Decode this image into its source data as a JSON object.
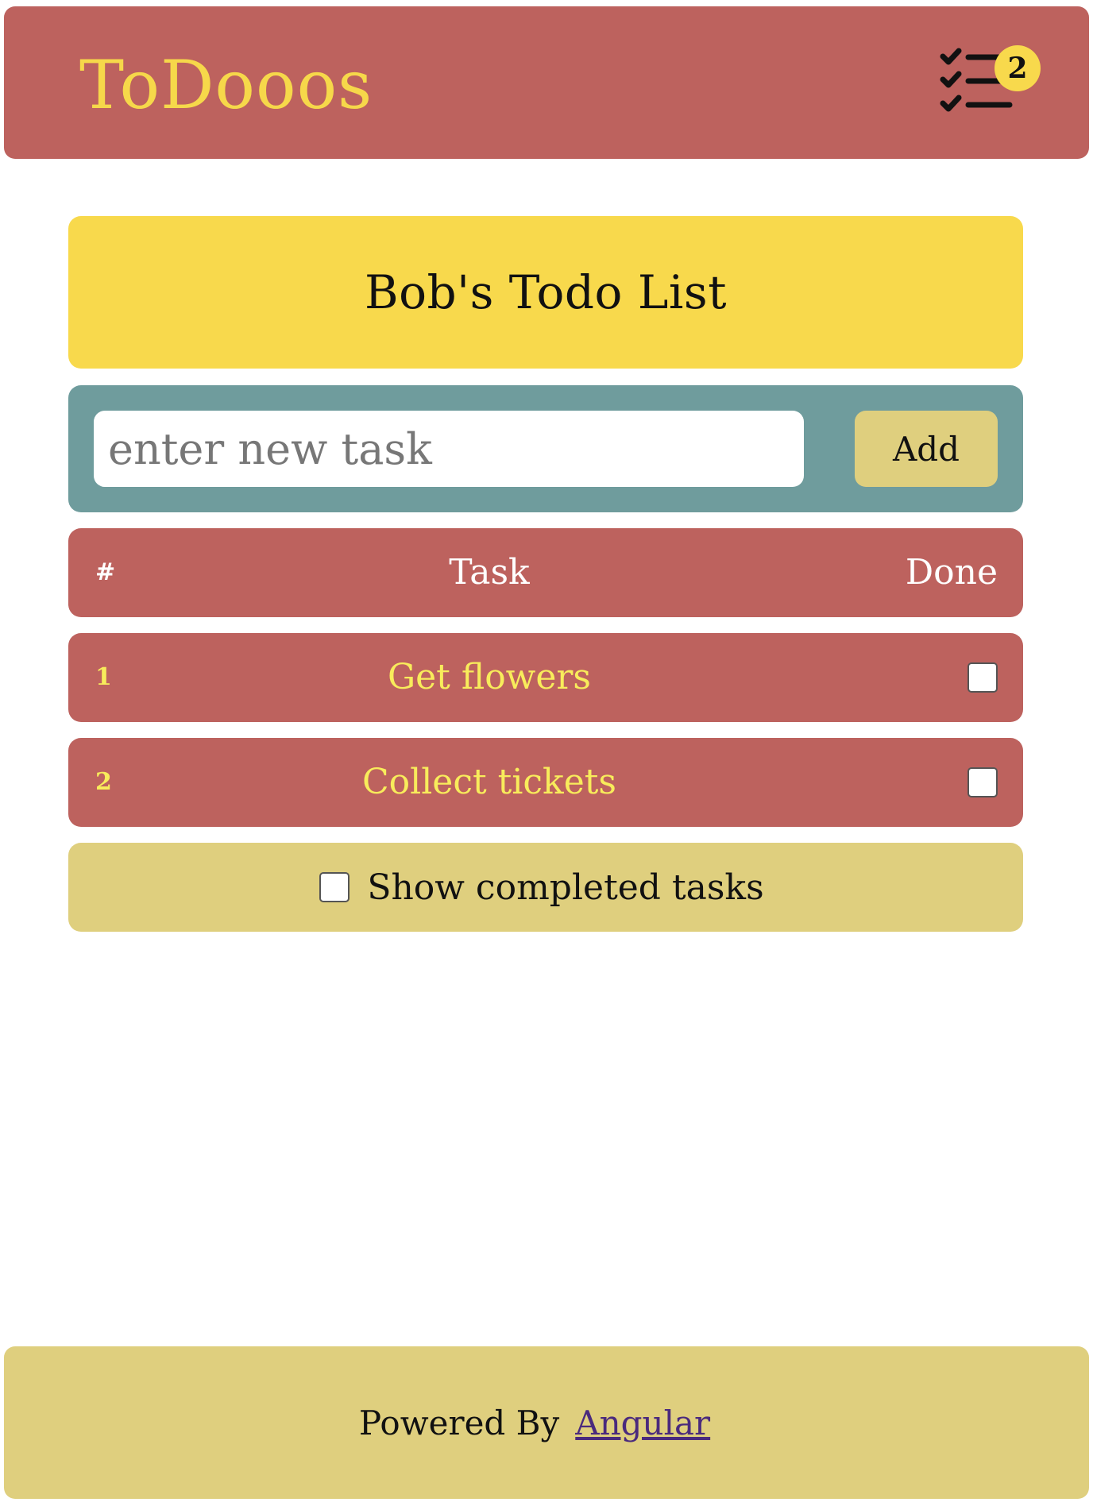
{
  "header": {
    "brand": "ToDooos",
    "tasks_icon": "checklist-icon",
    "pending_count": "2"
  },
  "title": "Bob's Todo List",
  "new_task": {
    "placeholder": "enter new task",
    "value": "",
    "add_label": "Add"
  },
  "table": {
    "headers": {
      "num": "#",
      "task": "Task",
      "done": "Done"
    },
    "rows": [
      {
        "num": "1",
        "task": "Get flowers",
        "done": false
      },
      {
        "num": "2",
        "task": "Collect tickets",
        "done": false
      }
    ]
  },
  "show_completed": {
    "label": "Show completed tasks",
    "checked": false
  },
  "footer": {
    "text": "Powered By",
    "link": "Angular"
  },
  "colors": {
    "header": "#bd625e",
    "brand_text": "#f6d84a",
    "title_card": "#f8d94c",
    "new_task_bar": "#6f9c9d",
    "button": "#dfcf7e",
    "row_text": "#f8ec5b",
    "footer": "#dfcf7e",
    "link": "#4a2a7d"
  }
}
